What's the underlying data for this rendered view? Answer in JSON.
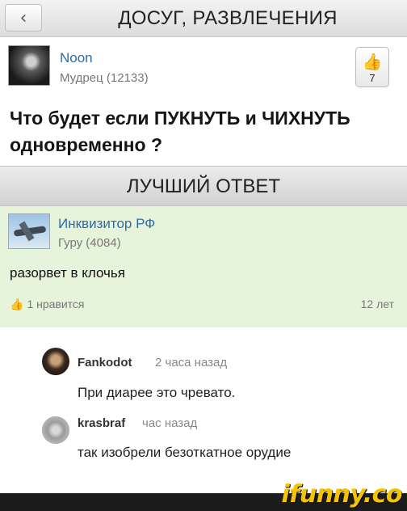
{
  "header": {
    "back_icon": "chevron-left-icon",
    "back_glyph": "‹",
    "category": "ДОСУГ, РАЗВЛЕЧЕНИЯ"
  },
  "question": {
    "author": "Noon",
    "rank": "Мудрец (12133)",
    "likes": "7",
    "like_icon": "thumbs-up-icon",
    "text": "Что будет если ПУКНУТЬ и ЧИХНУТЬ одновременно ?"
  },
  "best_answer": {
    "header": "ЛУЧШИЙ ОТВЕТ",
    "author": "Инквизитор РФ",
    "rank": "Гуру (4084)",
    "text": "разорвет в клочья",
    "likes": "1 нравится",
    "age": "12 лет"
  },
  "comments": [
    {
      "author": "Fankodot",
      "time": "2 часа назад",
      "text": "При диарее это чревато."
    },
    {
      "author": "krasbraf",
      "time": "час назад",
      "text": "так изобрели безоткатное орудие"
    }
  ],
  "watermark": "ifunny.co",
  "colors": {
    "link": "#2d6ba7",
    "answer_bg": "#e6f4dc",
    "watermark": "#f5c400"
  }
}
